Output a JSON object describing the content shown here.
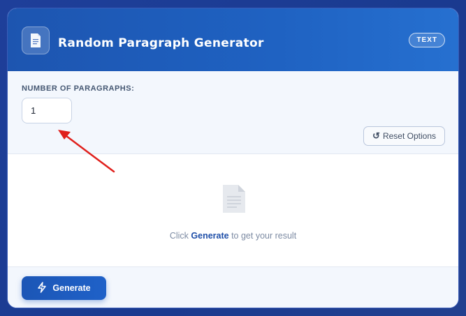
{
  "header": {
    "title": "Random Paragraph Generator",
    "badge": "TEXT",
    "icon": "document-icon"
  },
  "options": {
    "paragraphs_label": "NUMBER OF PARAGRAPHS:",
    "paragraphs_value": "1",
    "reset_label": "Reset Options",
    "reset_icon": "reset-icon"
  },
  "result": {
    "empty_prefix": "Click ",
    "empty_action": "Generate",
    "empty_suffix": " to get your result",
    "icon": "document-placeholder-icon"
  },
  "footer": {
    "generate_label": "Generate",
    "generate_icon": "lightning-icon"
  },
  "colors": {
    "background": "#1e3f9a",
    "header": "#1f5ec0",
    "accent": "#1e4ea8",
    "annotation_arrow": "#e0201c"
  }
}
